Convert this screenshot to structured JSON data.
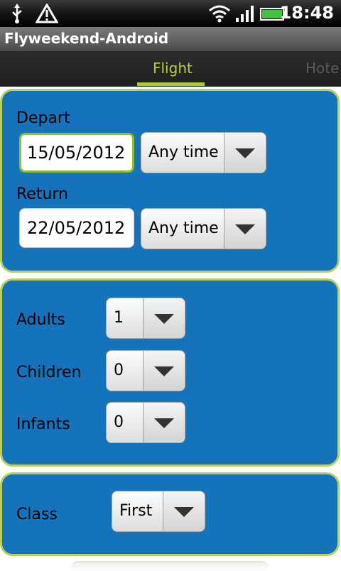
{
  "status_bar": {
    "time": "18:48",
    "icons": [
      "usb-icon",
      "warning-icon",
      "wifi-icon",
      "signal-icon",
      "battery-icon"
    ]
  },
  "app": {
    "title": "Flyweekend-Android"
  },
  "tabs": [
    {
      "label": "Flight",
      "active": true
    },
    {
      "label": "Hote",
      "active": false
    }
  ],
  "depart": {
    "label": "Depart",
    "date": "15/05/2012",
    "time": "Any time"
  },
  "return": {
    "label": "Return",
    "date": "22/05/2012",
    "time": "Any time"
  },
  "passengers": {
    "adults_label": "Adults",
    "adults_value": "1",
    "children_label": "Children",
    "children_value": "0",
    "infants_label": "Infants",
    "infants_value": "0"
  },
  "class": {
    "label": "Class",
    "value": "First"
  },
  "colors": {
    "panel_bg": "#1473bb",
    "panel_border": "#b7d25a",
    "tab_active": "#b5d334"
  }
}
